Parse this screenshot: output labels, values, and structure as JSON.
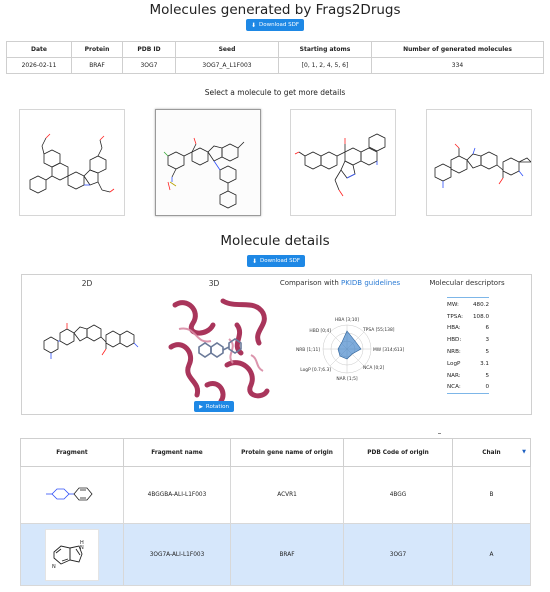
{
  "header": {
    "title": "Molecules generated by Frags2Drugs",
    "download_label": "Download SDF"
  },
  "info_table": {
    "columns": [
      "Date",
      "Protein",
      "PDB ID",
      "Seed",
      "Starting atoms",
      "Number of generated molecules"
    ],
    "row": [
      "2026-02-11",
      "BRAF",
      "3OG7",
      "3OG7_A_L1F003",
      "[0, 1, 2, 4, 5, 6]",
      "334"
    ]
  },
  "select_prompt": "Select a molecule to get more details",
  "details": {
    "title": "Molecule details",
    "download_label": "Download SDF",
    "tab_2d": "2D",
    "tab_3d": "3D",
    "comparison_prefix": "Comparison with ",
    "comparison_link": "PKIDB guidelines",
    "descriptors_title": "Molecular descriptors",
    "rotation_label": "Rotation",
    "radar_labels": {
      "hba": "HBA [3;10]",
      "tpsa": "TPSA [55;138]",
      "mw": "MW [314;613]",
      "nca": "NCA [0;2]",
      "nar": "NAR [1;5]",
      "logp": "LogP [0.7;6.3]",
      "nrb": "NRB [1;11]",
      "hbd": "HBD [0;4]"
    }
  },
  "descriptors": [
    {
      "name": "MW:",
      "value": "480.2"
    },
    {
      "name": "TPSA:",
      "value": "108.0"
    },
    {
      "name": "HBA:",
      "value": "6"
    },
    {
      "name": "HBD:",
      "value": "3"
    },
    {
      "name": "NRB:",
      "value": "5"
    },
    {
      "name": "LogP",
      "value": "3.1"
    },
    {
      "name": "NAR:",
      "value": "5"
    },
    {
      "name": "NCA:",
      "value": "0"
    }
  ],
  "fragments": {
    "columns": [
      "Fragment",
      "Fragment name",
      "Protein gene name of origin",
      "PDB Code of origin",
      "Chain"
    ],
    "rows": [
      {
        "name": "4BGGBA-ALI-L1F003",
        "gene": "ACVR1",
        "pdb": "4BGG",
        "chain": "B"
      },
      {
        "name": "3OG7A-ALI-L1F003",
        "gene": "BRAF",
        "pdb": "3OG7",
        "chain": "A"
      }
    ]
  },
  "colors": {
    "accent": "#1e88e5",
    "selected_row": "#d6e7fb",
    "protein": "#a0204a",
    "link": "#2b7bd4"
  }
}
